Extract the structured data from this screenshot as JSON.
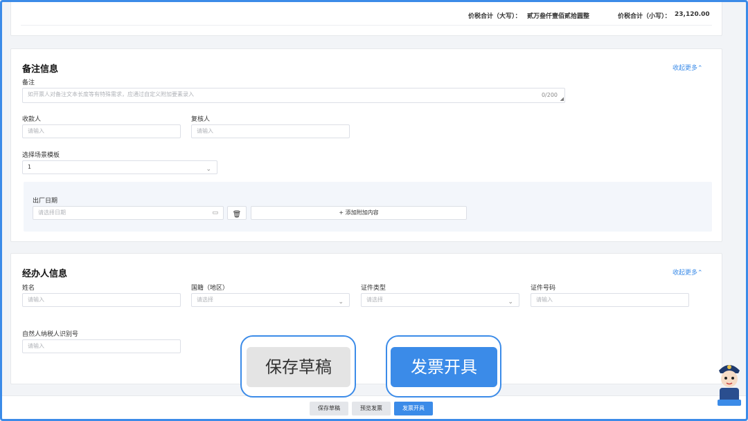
{
  "totals": {
    "uppercase_label": "价税合计（大写）：",
    "uppercase_value": "贰万叁仟壹佰贰拾圆整",
    "lowercase_label": "价税合计（小写）：",
    "lowercase_value": "23,120.00"
  },
  "remarks": {
    "title": "备注信息",
    "collapse_link": "收起更多⌃",
    "remark_label": "备注",
    "remark_placeholder": "如开票人对备注文本长度等有特殊需求，应通过自定义附加要素录入",
    "remark_counter": "0/200",
    "payee_label": "收款人",
    "payee_placeholder": "请输入",
    "reviewer_label": "复核人",
    "reviewer_placeholder": "请输入",
    "template_label": "选择场景模板",
    "template_value": "1",
    "factory_date_label": "出厂日期",
    "factory_date_placeholder": "请选择日期",
    "add_extra_label": "+  添加附加内容"
  },
  "handler": {
    "title": "经办人信息",
    "collapse_link": "收起更多⌃",
    "name_label": "姓名",
    "name_placeholder": "请输入",
    "nationality_label": "国籍（地区）",
    "nationality_placeholder": "请选择",
    "id_type_label": "证件类型",
    "id_type_placeholder": "请选择",
    "id_number_label": "证件号码",
    "id_number_placeholder": "请输入",
    "taxpayer_id_label": "自然人纳税人识别号",
    "taxpayer_id_placeholder": "请输入"
  },
  "callouts": {
    "save_draft": "保存草稿",
    "issue_invoice": "发票开具"
  },
  "footer": {
    "save_draft": "保存草稿",
    "preview": "预览发票",
    "issue": "发票开具"
  },
  "colors": {
    "accent": "#3b8be8",
    "page_bg": "#f2f4f7"
  }
}
